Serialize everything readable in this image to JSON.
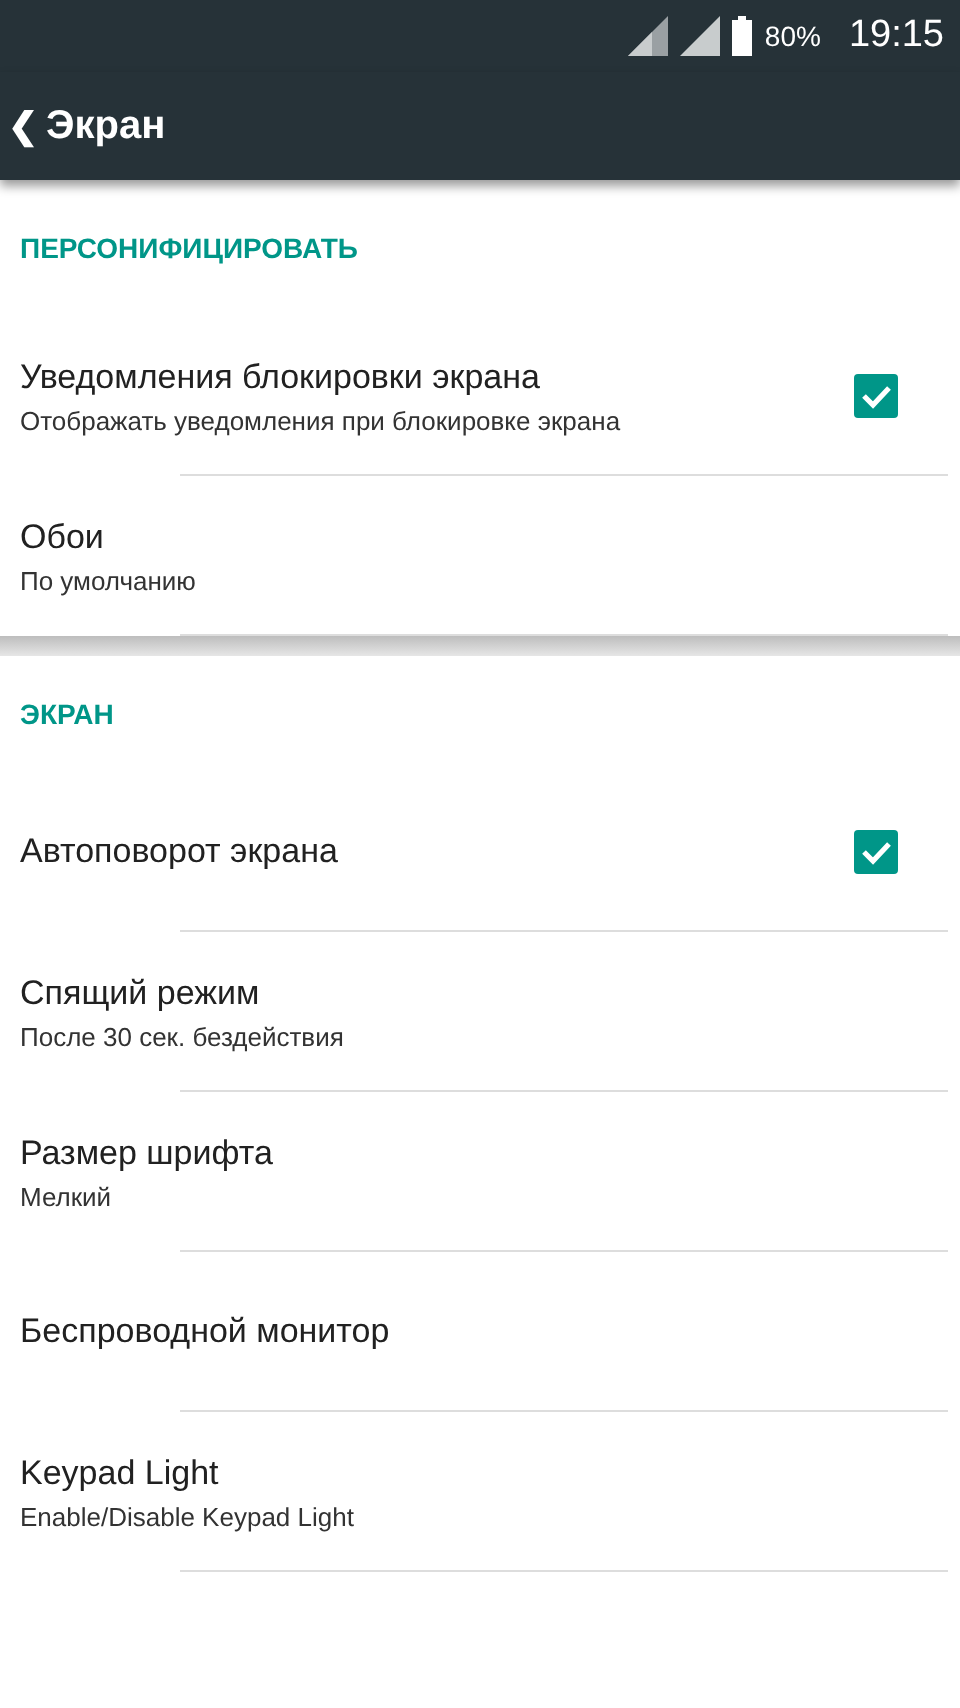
{
  "status_bar": {
    "battery": "80%",
    "time": "19:15"
  },
  "app_bar": {
    "back": "❮",
    "title": "Экран"
  },
  "sections": [
    {
      "title": "ПЕРСОНИФИЦИРОВАТЬ",
      "items": [
        {
          "kind": "checkbox",
          "title": "Уведомления блокировки экрана",
          "summary": "Отображать уведомления при блокировке экрана",
          "checked": true
        },
        {
          "kind": "plain",
          "title": "Обои",
          "summary": "По умолчанию"
        }
      ]
    },
    {
      "title": "ЭКРАН",
      "items": [
        {
          "kind": "checkbox",
          "title": "Автоповорот экрана",
          "checked": true
        },
        {
          "kind": "plain",
          "title": "Спящий режим",
          "summary": "После 30 сек. бездействия"
        },
        {
          "kind": "plain",
          "title": "Размер шрифта",
          "summary": "Мелкий"
        },
        {
          "kind": "plain",
          "title": "Беспроводной монитор"
        },
        {
          "kind": "plain",
          "title": "Keypad Light",
          "summary": "Enable/Disable Keypad Light"
        }
      ]
    }
  ]
}
